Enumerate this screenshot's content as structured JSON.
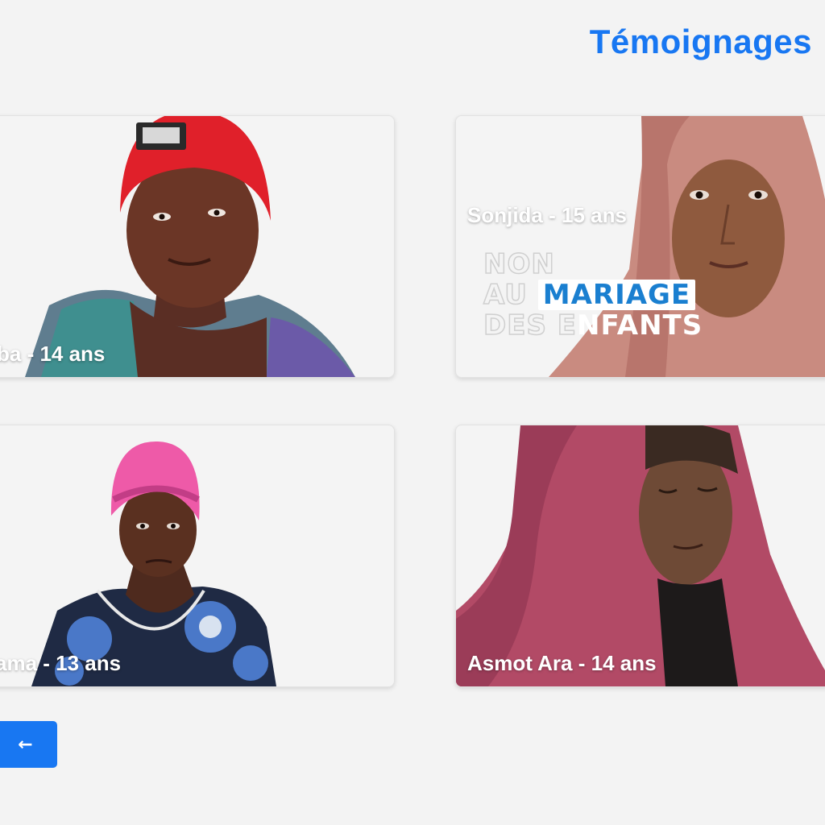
{
  "page": {
    "title": "Témoignages"
  },
  "testimonials": [
    {
      "label": "ba - 14 ans"
    },
    {
      "label": "Sonjida - 15 ans"
    },
    {
      "label": "ama - 13 ans"
    },
    {
      "label": "Asmot Ara - 14 ans"
    }
  ],
  "campaign_badge": {
    "line1": "NON",
    "line2_prefix": "AU",
    "line2_highlight": "MARIAGE",
    "line3_prefix": "DES E",
    "line3_rest": "NFANTS"
  },
  "navigation": {
    "prev_icon": "arrow-left-icon",
    "prev_glyph": "←"
  },
  "colors": {
    "accent": "#1877f2",
    "background": "#f3f3f3"
  }
}
